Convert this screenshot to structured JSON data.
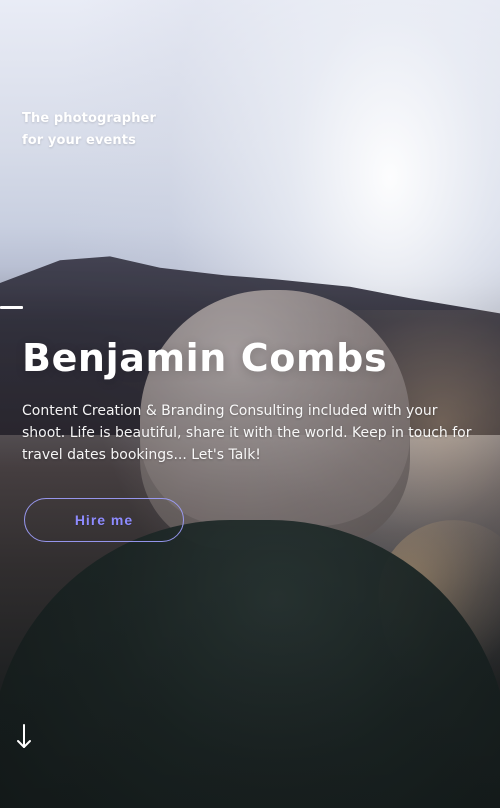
{
  "hero": {
    "tagline_line1": "The photographer",
    "tagline_line2": "for your events",
    "name": "Benjamin Combs",
    "description_line1": "Content Creation & Branding Consulting included with your",
    "description_line2": "shoot. Life is beautiful, share it with the world. Keep in touch for",
    "description_line3": "travel dates bookings... Let's Talk!",
    "button_label": "Hire me",
    "scroll_icon": "arrow-down-icon"
  },
  "colors": {
    "text": "#ffffff",
    "button_text": "#8e8bff",
    "button_border": "#a0a0ff"
  }
}
